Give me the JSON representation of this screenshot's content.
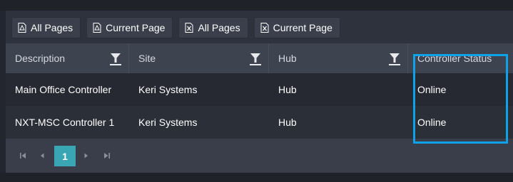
{
  "toolbar": {
    "buttons": [
      {
        "icon": "pdf-icon",
        "label": "All Pages"
      },
      {
        "icon": "pdf-icon",
        "label": "Current Page"
      },
      {
        "icon": "excel-icon",
        "label": "All Pages"
      },
      {
        "icon": "excel-icon",
        "label": "Current Page"
      }
    ]
  },
  "grid": {
    "columns": [
      "Description",
      "Site",
      "Hub",
      "Controller Status"
    ],
    "rows": [
      [
        "Main Office Controller",
        "Keri Systems",
        "Hub",
        "Online"
      ],
      [
        "NXT-MSC Controller 1",
        "Keri Systems",
        "Hub",
        "Online"
      ]
    ]
  },
  "pager": {
    "current_page": "1",
    "icons": [
      "first-page-icon",
      "prev-page-icon",
      "next-page-icon",
      "last-page-icon"
    ]
  },
  "colors": {
    "accent_page": "#3aa5b3",
    "highlight_box": "#0ea2e8"
  }
}
